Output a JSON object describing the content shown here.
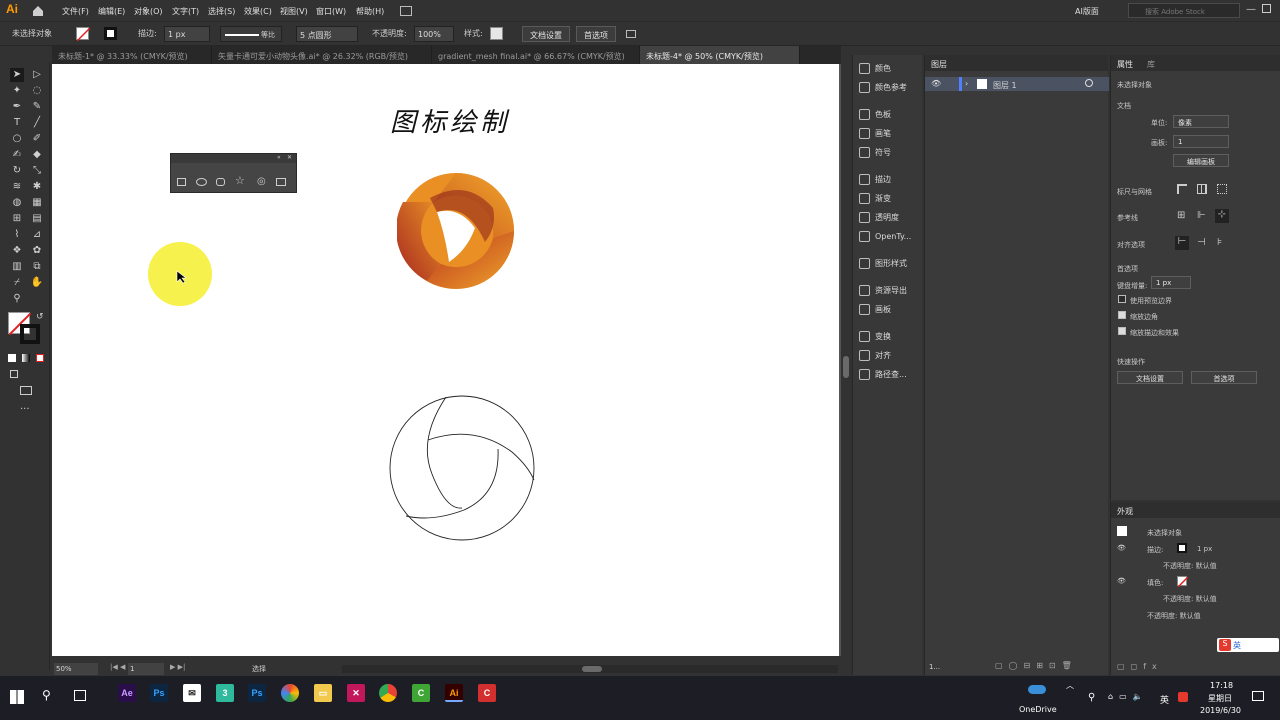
{
  "app": {
    "logo": "Ai",
    "workspace": "AI版面",
    "search_placeholder": "搜索 Adobe Stock"
  },
  "menu": [
    "文件(F)",
    "编辑(E)",
    "对象(O)",
    "文字(T)",
    "选择(S)",
    "效果(C)",
    "视图(V)",
    "窗口(W)",
    "帮助(H)"
  ],
  "control_bar": {
    "selection": "未选择对象",
    "stroke_label": "描边:",
    "stroke_value": "1 px",
    "profile": "等比",
    "brush": "5 点圆形",
    "opacity_label": "不透明度:",
    "opacity_value": "100%",
    "style_label": "样式:",
    "doc_setup": "文档设置",
    "prefs": "首选项"
  },
  "tabs": [
    {
      "label": "未标题-1* @ 33.33% (CMYK/预览)",
      "active": false
    },
    {
      "label": "矢量卡通可爱小动物头像.ai* @ 26.32% (RGB/预览)",
      "active": false
    },
    {
      "label": "gradient_mesh final.ai* @ 66.67% (CMYK/预览)",
      "active": false
    },
    {
      "label": "未标题-4* @ 50% (CMYK/预览)",
      "active": true
    }
  ],
  "artboard": {
    "title": "图标绘制"
  },
  "statusbar": {
    "zoom": "50%",
    "page": "1",
    "tool": "选择"
  },
  "dock": [
    "颜色",
    "颜色参考",
    "色板",
    "画笔",
    "符号",
    "描边",
    "渐变",
    "透明度",
    "OpenTy...",
    "图形样式",
    "资源导出",
    "画板",
    "变换",
    "对齐",
    "路径查..."
  ],
  "layers": {
    "title": "图层",
    "layer_name": "图层 1",
    "footer": "1..."
  },
  "properties": {
    "tab1": "属性",
    "tab2": "库",
    "no_selection": "未选择对象",
    "doc": "文档",
    "units_label": "单位:",
    "units_value": "像素",
    "artboard_label": "画板:",
    "artboard_value": "1",
    "edit_artboard": "编辑画板",
    "rulers": "标尺与网格",
    "guides": "参考线",
    "align": "对齐选项",
    "prefs": "首选项",
    "keyboard_label": "键盘增量:",
    "keyboard_value": "1 px",
    "cb1": "使用预览边界",
    "cb2": "缩放边角",
    "cb3": "缩放描边和效果",
    "quick": "快速操作",
    "qbtn1": "文档设置",
    "qbtn2": "首选项"
  },
  "appearance": {
    "title": "外观",
    "no_selection": "未选择对象",
    "stroke_label": "描边:",
    "stroke_value": "1 px",
    "opacity1": "不透明度: 默认值",
    "fill_label": "填色:",
    "opacity2": "不透明度: 默认值",
    "opacity3": "不透明度: 默认值"
  },
  "taskbar": {
    "onedrive": "OneDrive",
    "lang": "英",
    "time": "17:18",
    "day": "星期日",
    "date": "2019/6/30"
  },
  "ime": {
    "label": "英"
  },
  "colors": {
    "accent": "#ff9a00",
    "cursor_highlight": "#f5f03a",
    "taskbar": "#1c1d25"
  }
}
